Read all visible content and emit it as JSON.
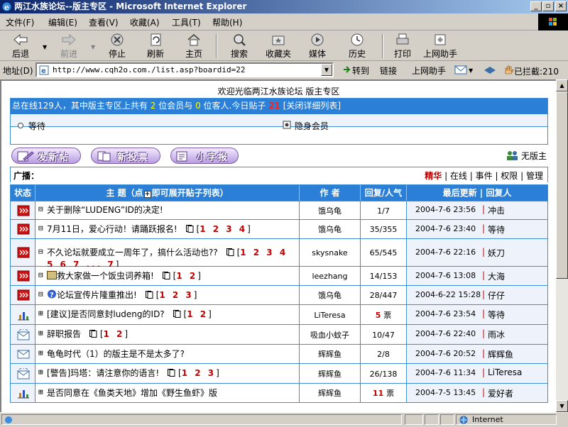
{
  "window": {
    "title": "两江水族论坛--版主专区 - Microsoft Internet Explorer",
    "buttons": [
      "_",
      "▫",
      "×"
    ]
  },
  "menu": [
    "文件(F)",
    "编辑(E)",
    "查看(V)",
    "收藏(A)",
    "工具(T)",
    "帮助(H)"
  ],
  "toolbar": {
    "back": "后退",
    "forward": "前进",
    "stop": "停止",
    "refresh": "刷新",
    "home": "主页",
    "search": "搜索",
    "favorites": "收藏夹",
    "media": "媒体",
    "history": "历史",
    "print": "打印",
    "helper": "上网助手"
  },
  "address": {
    "label": "地址(D)",
    "url": "http://www.cqh2o.com./list.asp?boardid=22",
    "go": "转到",
    "links": "链接",
    "helper": "上网助手",
    "blocked": "已拦截:210"
  },
  "page": {
    "welcome": "欢迎光临两江水族论坛 版主专区",
    "online": {
      "prefix": "总在线",
      "total": "129",
      "mid1": "人，其中版主专区上共有",
      "members": "2",
      "mid2": "位会员与",
      "guests": "0",
      "mid3": "位客人.今日贴子",
      "today": "21",
      "link": "[关闭详细列表]"
    },
    "legend": {
      "waiting": "等待",
      "hidden": "隐身会员"
    },
    "buttons": {
      "new_post": "发新帖",
      "new_vote": "新投票",
      "small_report": "小字报"
    },
    "no_moderator": "无版主",
    "broadcast": {
      "label": "广播：",
      "hot": "精华",
      "links": [
        "在线",
        "事件",
        "权限",
        "管理"
      ]
    },
    "headers": {
      "status": "状态",
      "title_pre": "主 题（点",
      "title_post": "即可展开贴子列表）",
      "author": "作 者",
      "reply": "回复/人气",
      "last": "最后更新 | 回复人"
    },
    "rows": [
      {
        "icon": "hot",
        "toggle": "⊟",
        "title": "关于删除“LUDENG”ID的决定!",
        "pages": "",
        "author": "饿乌龟",
        "reply": "1/7",
        "time": "2004-7-6 23:56",
        "replier": "冲击"
      },
      {
        "icon": "hot",
        "toggle": "⊟",
        "title": "7月11日，爱心行动！请踊跃报名!",
        "pages": "1 2 3 4",
        "author": "饿乌龟",
        "reply": "35/355",
        "time": "2004-7-6 23:40",
        "replier": "等待"
      },
      {
        "icon": "hot",
        "toggle": "⊟",
        "title": "不久论坛就要成立一周年了，搞什么活动也??",
        "pages": "1 2 3 4 5 6 7 ... 7",
        "author": "skysnake",
        "reply": "65/545",
        "time": "2004-7-6 22:16",
        "replier": "妖刀"
      },
      {
        "icon": "hot",
        "toggle": "⊟",
        "title": "救大家做一个饭虫词养箱!",
        "pages": "1 2",
        "author": "leezhang",
        "reply": "14/153",
        "time": "2004-7-6 13:08",
        "replier": "大海"
      },
      {
        "icon": "hot",
        "toggle": "⊟",
        "title": "论坛宣传片隆重推出!",
        "pages": "1 2 3",
        "author": "饿乌龟",
        "reply": "28/447",
        "time": "2004-6-22 15:28",
        "replier": "仔仔"
      },
      {
        "icon": "vote",
        "toggle": "⊞",
        "title": "[建议]是否同意封ludeng的ID?",
        "pages": "1 2",
        "author": "LiTeresa",
        "reply_num": "5",
        "reply_unit": "票",
        "time": "2004-7-6 23:54",
        "replier": "等待"
      },
      {
        "icon": "mailnew",
        "toggle": "⊞",
        "title": "辞职报告",
        "pages": "1 2",
        "author": "吸血小蚊子",
        "reply": "10/47",
        "time": "2004-7-6 22:40",
        "replier": "雨冰"
      },
      {
        "icon": "mail",
        "toggle": "⊞",
        "title": "龟龟时代（1）的版主是不是太多了?",
        "pages": "",
        "author": "辉辉鱼",
        "reply": "2/8",
        "time": "2004-7-6 20:52",
        "replier": "辉辉鱼"
      },
      {
        "icon": "mailnew",
        "toggle": "⊞",
        "title": "[警告]玛塔：请注意你的语言!",
        "pages": "1 2 3",
        "author": "辉辉鱼",
        "reply": "26/138",
        "time": "2004-7-6 11:34",
        "replier": "LiTeresa"
      },
      {
        "icon": "vote",
        "toggle": "⊞",
        "title": "是否同意在《鱼类天地》增加《野生鱼虾》版",
        "pages": "",
        "author": "辉辉鱼",
        "reply_num": "11",
        "reply_unit": "票",
        "time": "2004-7-5 13:45",
        "replier": "爱好者"
      }
    ]
  },
  "status": {
    "zone": "Internet"
  },
  "colors": {
    "titlebar": "#0a246a",
    "accent": "#2b7fd6",
    "hot": "#c00000"
  }
}
